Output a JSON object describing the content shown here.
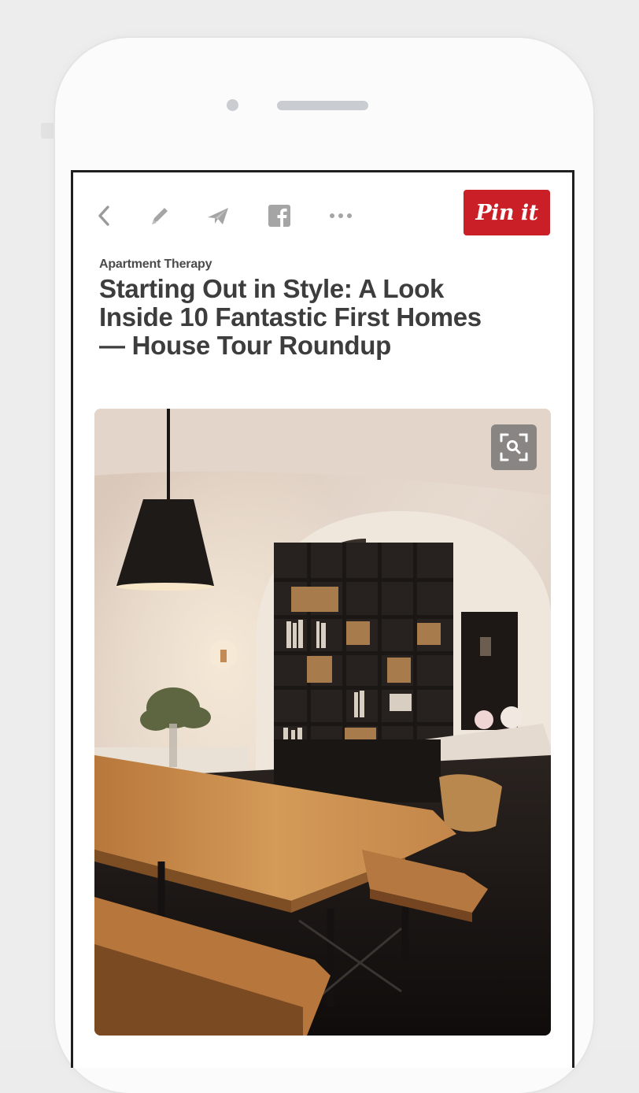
{
  "pin": {
    "source": "Apartment Therapy",
    "title": "Starting Out in Style: A Look Inside 10 Fantastic First Homes — House Tour Roundup",
    "pin_label": "Pin it"
  },
  "toolbar": {
    "icons": [
      "back-icon",
      "edit-icon",
      "send-icon",
      "facebook-icon",
      "more-icon"
    ]
  },
  "image": {
    "description_icon": "visual-search-icon"
  },
  "colors": {
    "pin_button": "#cb1f27",
    "title_text": "#3d3d3d",
    "icon_gray": "#9a9a9a"
  }
}
